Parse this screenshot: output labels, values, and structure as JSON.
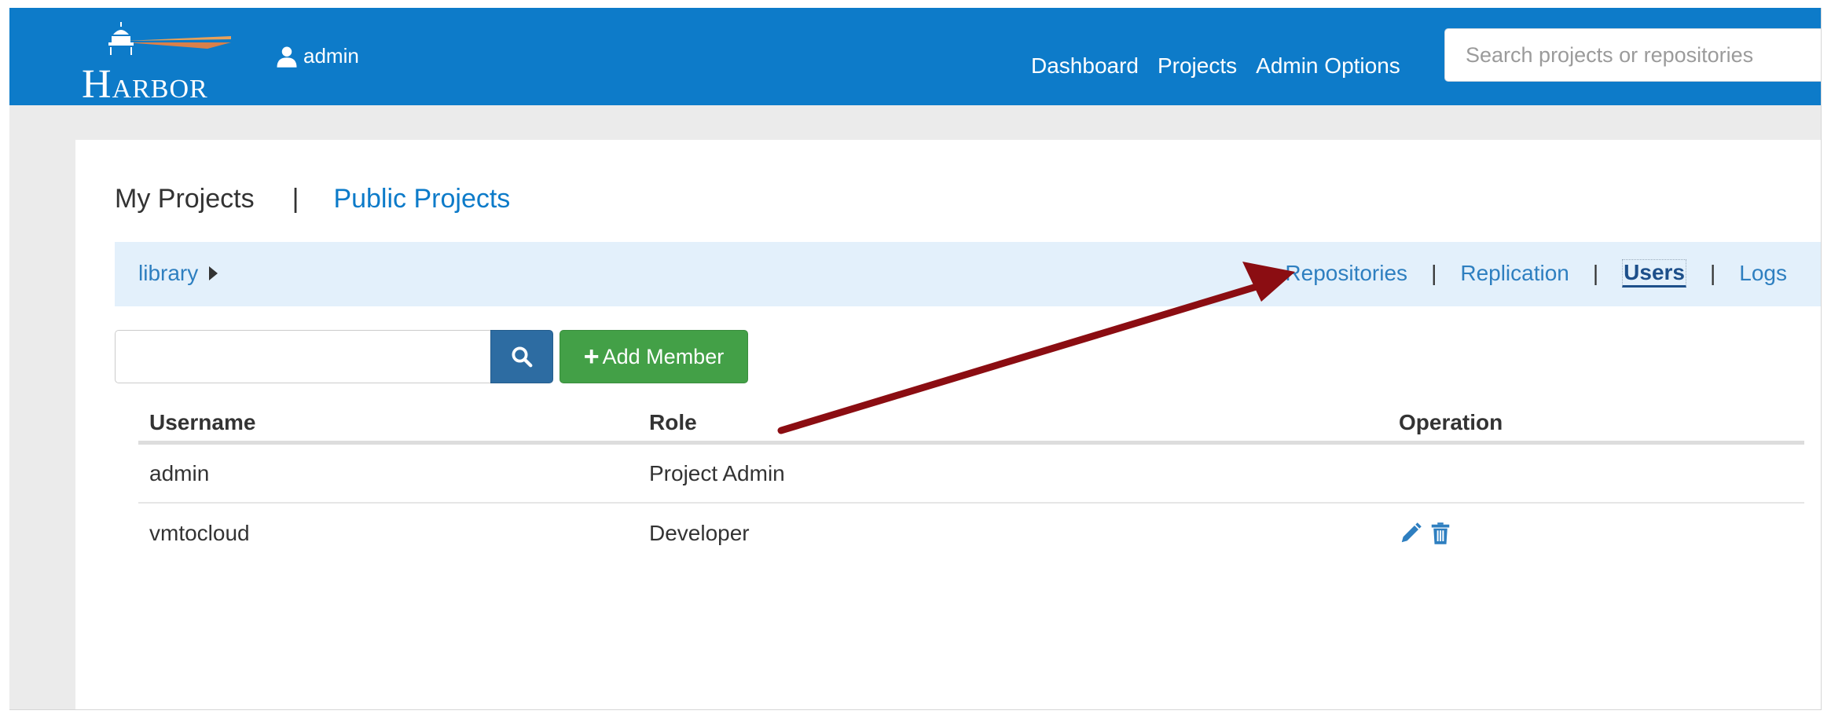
{
  "navbar": {
    "logo_text_first": "H",
    "logo_text_rest": "ARBOR",
    "user": "admin",
    "links": [
      "Dashboard",
      "Projects",
      "Admin Options"
    ],
    "search_placeholder": "Search projects or repositories"
  },
  "project_tabs": {
    "my_projects": "My Projects",
    "separator": "|",
    "public_projects": "Public Projects"
  },
  "subbar": {
    "breadcrumb": "library",
    "tabs": [
      {
        "label": "Repositories",
        "active": false
      },
      {
        "label": "Replication",
        "active": false
      },
      {
        "label": "Users",
        "active": true
      },
      {
        "label": "Logs",
        "active": false
      }
    ],
    "separator": "|"
  },
  "toolbar": {
    "filter_value": "",
    "add_label": "Add Member",
    "add_plus": "+"
  },
  "table": {
    "headers": [
      "Username",
      "Role",
      "Operation"
    ],
    "rows": [
      {
        "username": "admin",
        "role": "Project Admin",
        "operations": []
      },
      {
        "username": "vmtocloud",
        "role": "Developer",
        "operations": [
          "edit-icon",
          "trash-icon"
        ]
      }
    ]
  },
  "colors": {
    "navbar": "#0d7bc9",
    "link": "#2e7fc0",
    "add_button": "#43a047",
    "search_button": "#2d6ca2",
    "annotation_arrow": "#8b0d12"
  }
}
